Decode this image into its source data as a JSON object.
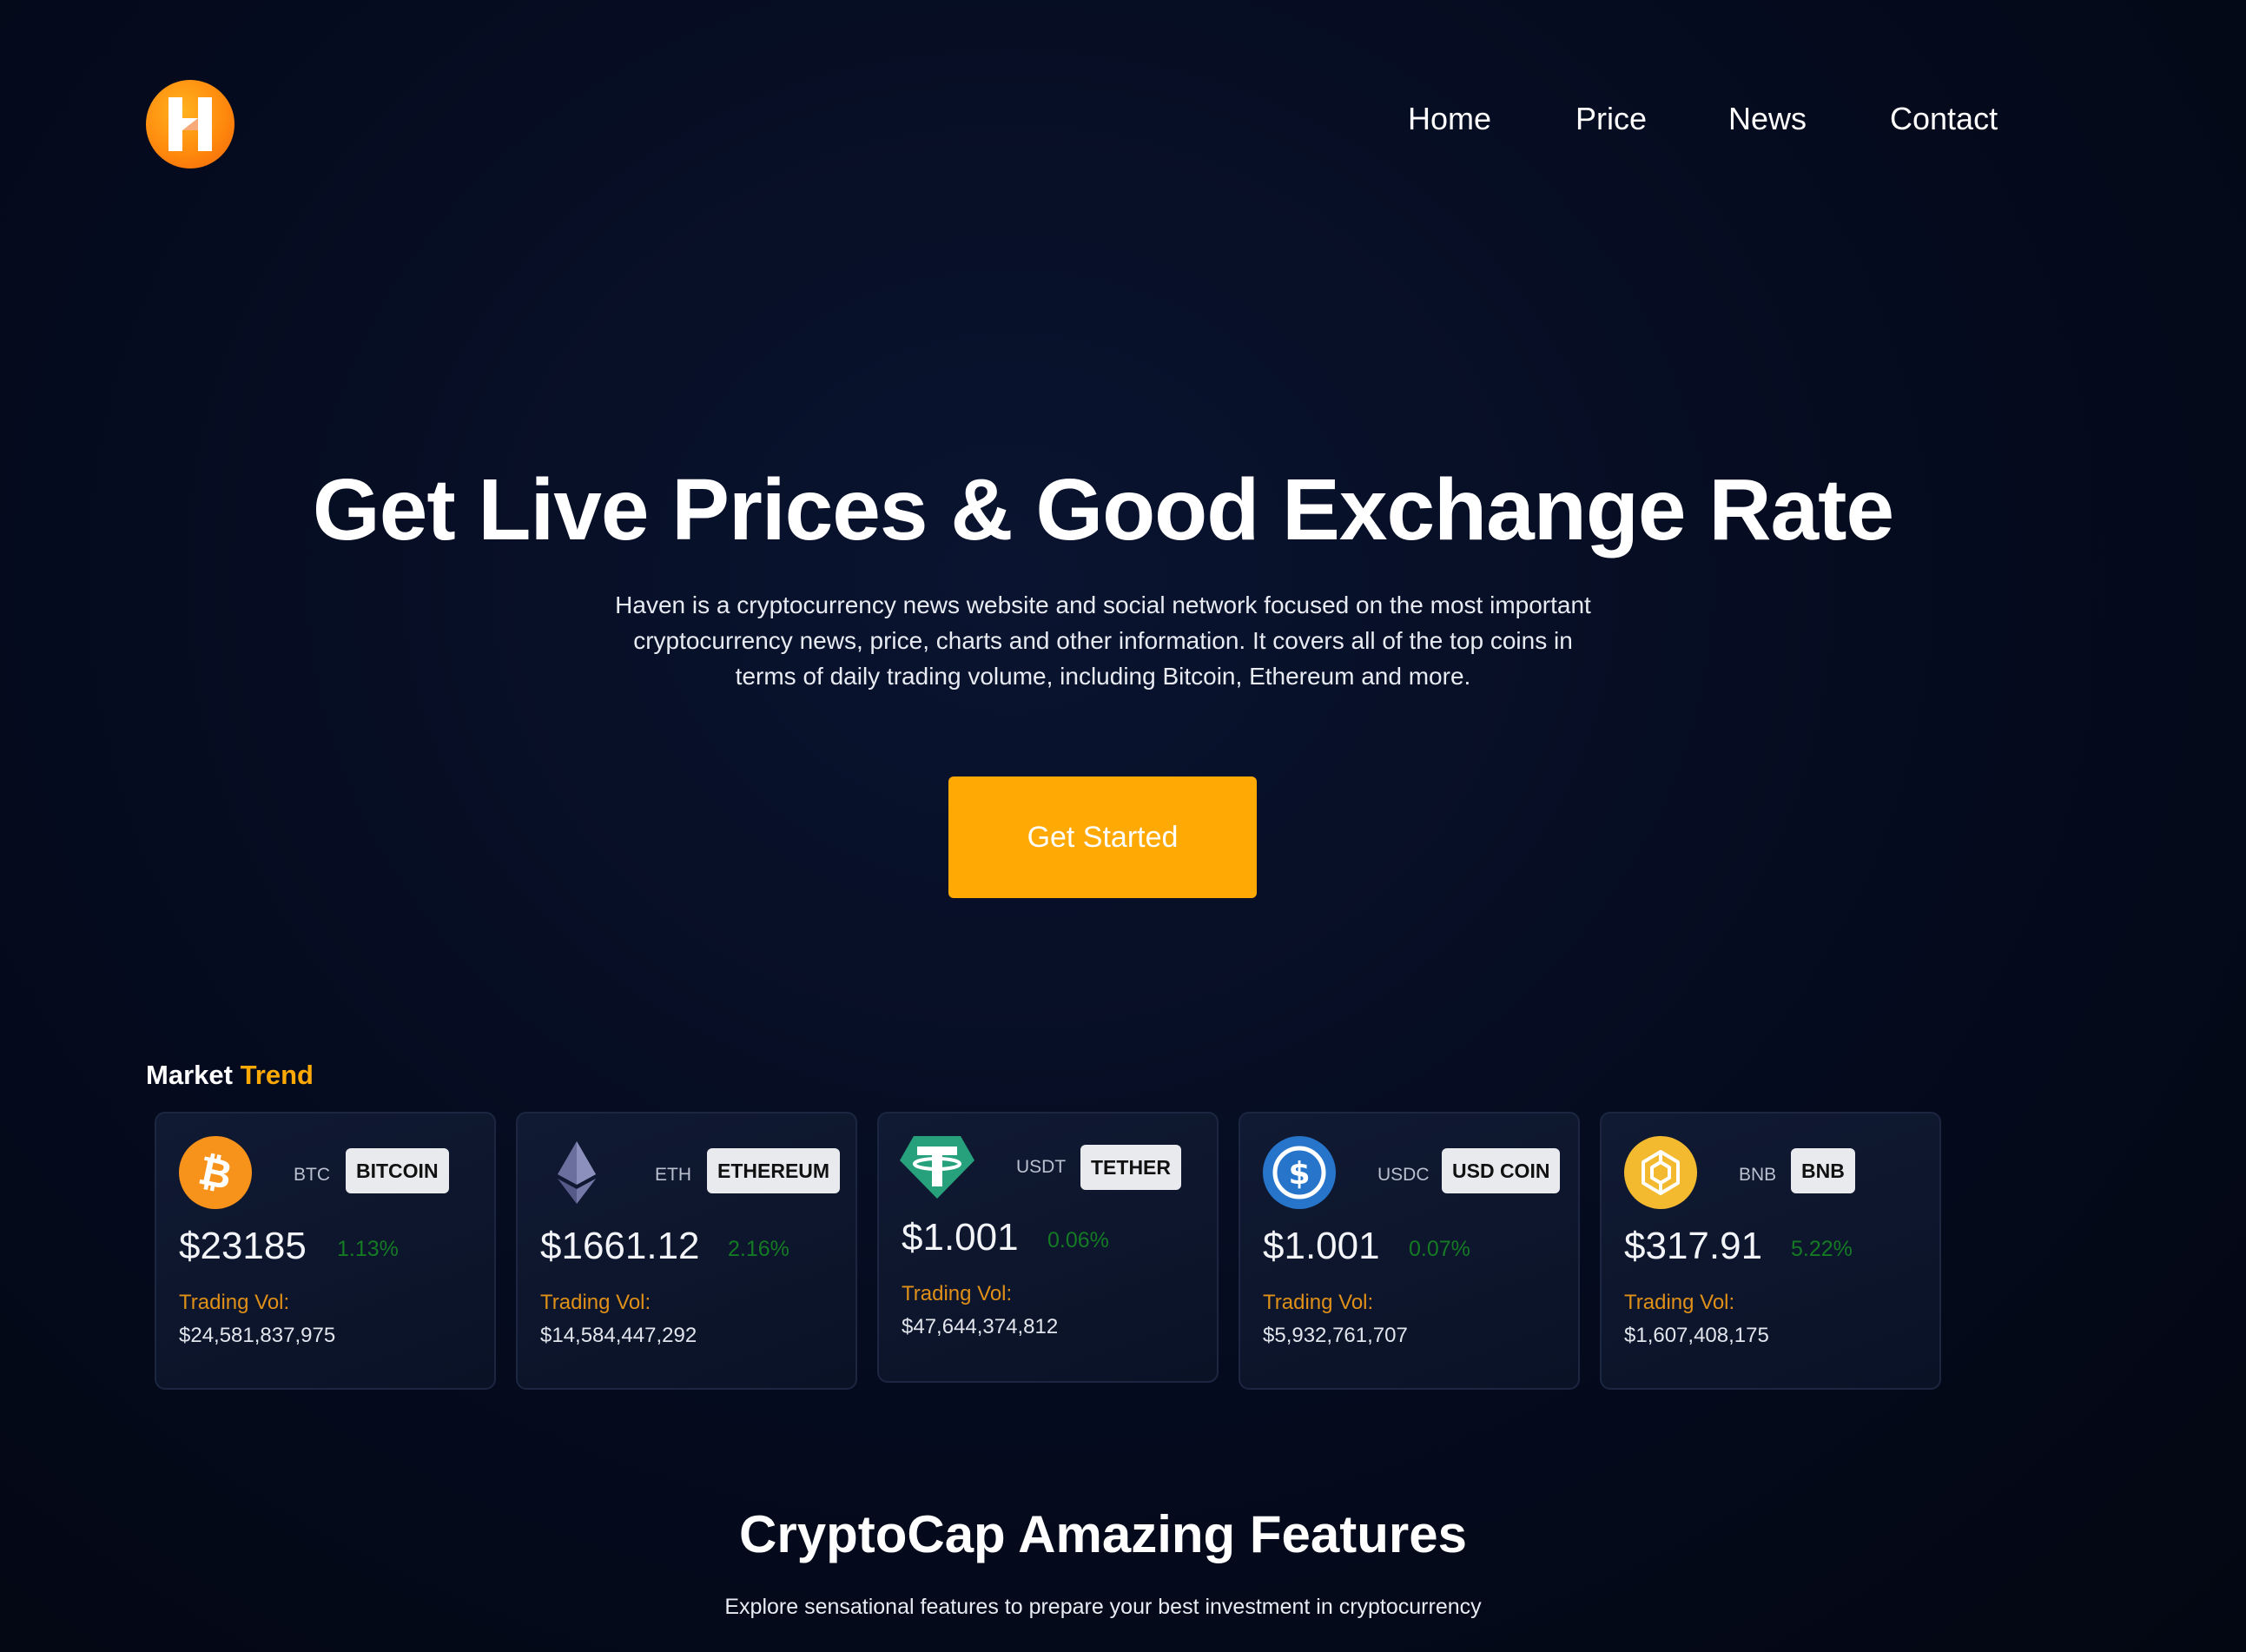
{
  "header": {
    "logo_letter": "H",
    "nav": [
      "Home",
      "Price",
      "News",
      "Contact"
    ]
  },
  "hero": {
    "title": "Get Live Prices & Good Exchange Rate",
    "description": "Haven is a cryptocurrency news website and social network focused on the most important cryptocurrency news, price, charts and other information. It covers all of the top coins in terms of daily trading volume, including Bitcoin, Ethereum and more.",
    "cta_label": "Get Started"
  },
  "market": {
    "title_part1": "Market",
    "title_part2": "Trend",
    "cards": [
      {
        "symbol": "BTC",
        "name": "BITCOIN",
        "price": "$23185",
        "change": "1.13%",
        "vol_label": "Trading Vol:",
        "vol": "$24,581,837,975",
        "icon": "bitcoin-icon",
        "color": "#f7931a"
      },
      {
        "symbol": "ETH",
        "name": "ETHEREUM",
        "price": "$1661.12",
        "change": "2.16%",
        "vol_label": "Trading Vol:",
        "vol": "$14,584,447,292",
        "icon": "ethereum-icon",
        "color": "#627eea"
      },
      {
        "symbol": "USDT",
        "name": "TETHER",
        "price": "$1.001",
        "change": "0.06%",
        "vol_label": "Trading Vol:",
        "vol": "$47,644,374,812",
        "icon": "tether-icon",
        "color": "#26a17b"
      },
      {
        "symbol": "USDC",
        "name": "USD COIN",
        "price": "$1.001",
        "change": "0.07%",
        "vol_label": "Trading Vol:",
        "vol": "$5,932,761,707",
        "icon": "usd-coin-icon",
        "color": "#2775ca"
      },
      {
        "symbol": "BNB",
        "name": "BNB",
        "price": "$317.91",
        "change": "5.22%",
        "vol_label": "Trading Vol:",
        "vol": "$1,607,408,175",
        "icon": "bnb-icon",
        "color": "#f3ba2f"
      }
    ]
  },
  "features": {
    "title": "CryptoCap Amazing Features",
    "subtitle": "Explore sensational features to prepare your best investment in cryptocurrency"
  },
  "colors": {
    "accent": "#ffa905",
    "positive": "#157a24",
    "background": "#050b1e"
  }
}
